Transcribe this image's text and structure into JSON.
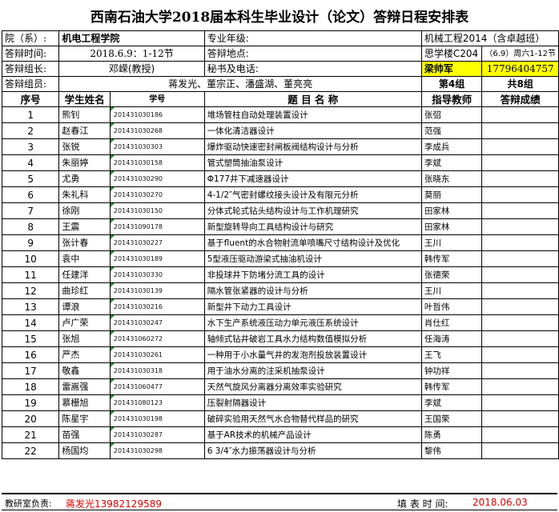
{
  "title": "西南石油大学2018届本科生毕业设计（论文）答辩日程安排表",
  "info": {
    "dept_label": "院（系）:",
    "dept_value": "机电工程学院",
    "major_label": "专业年级:",
    "major_value": "机械工程2014（含卓越班）",
    "time_label": "答辩时间:",
    "time_value": "2018.6.9：1-12节",
    "place_label": "答辩地点:",
    "place_value": "思学楼C204",
    "note_value": "（6.9）周六1-12节",
    "leader_label": "答辩组长:",
    "leader_value": "邓嵘(教授)",
    "secretary_label": "秘书及电话:",
    "secretary_name": "梁帅军",
    "secretary_phone": "17796404757",
    "members_label": "答辩组员:",
    "members_value": "蒋发光、董宗正、潘盛湖、董亮亮",
    "group_no": "第4组",
    "group_total": "共8组"
  },
  "columns": {
    "no": "序号",
    "student": "学生姓名",
    "sid": "学号",
    "topic": "题 目 名 称",
    "advisor": "指导教师",
    "score": "答辩成绩"
  },
  "rows": [
    {
      "no": "1",
      "name": "熊钊",
      "sid": "201431030186",
      "topic": "堆场管柱自动处理装置设计",
      "advisor": "张弨"
    },
    {
      "no": "2",
      "name": "赵春江",
      "sid": "201431030268",
      "topic": "一体化清洁器设计",
      "advisor": "范强"
    },
    {
      "no": "3",
      "name": "张锐",
      "sid": "201431030303",
      "topic": "爆炸驱动快速密封闸板阀结构设计与分析",
      "advisor": "李成兵"
    },
    {
      "no": "4",
      "name": "朱丽婷",
      "sid": "201431030158",
      "topic": "管式塑筒抽油泵设计",
      "advisor": "李斌"
    },
    {
      "no": "5",
      "name": "尤勇",
      "sid": "201431030290",
      "topic": "Φ177井下减速器设计",
      "advisor": "张晓东"
    },
    {
      "no": "6",
      "name": "朱礼科",
      "sid": "201431030270",
      "topic": "4-1/2″气密封螺纹接头设计及有限元分析",
      "advisor": "莫丽"
    },
    {
      "no": "7",
      "name": "徐刚",
      "sid": "201431030150",
      "topic": "分体式轮式钻头结构设计与工作机理研究",
      "advisor": "田家林"
    },
    {
      "no": "8",
      "name": "王震",
      "sid": "201431090178",
      "topic": "新型旋转导向工具结构设计与研究",
      "advisor": "田家林"
    },
    {
      "no": "9",
      "name": "张计春",
      "sid": "201431030227",
      "topic": "基于fluent的水合物射流单喷嘴尺寸结构设计及优化",
      "advisor": "王川"
    },
    {
      "no": "10",
      "name": "袁中",
      "sid": "201431030189",
      "topic": "5型液压驱动游梁式抽油机设计",
      "advisor": "韩传军"
    },
    {
      "no": "11",
      "name": "任建洋",
      "sid": "201431030330",
      "topic": "非投球井下防堵分流工具的设计",
      "advisor": "张德荣"
    },
    {
      "no": "12",
      "name": "曲珍红",
      "sid": "201431030139",
      "topic": "隔水管张紧器的设计与分析",
      "advisor": "王川"
    },
    {
      "no": "13",
      "name": "谭浪",
      "sid": "201431030216",
      "topic": "新型井下动力工具设计",
      "advisor": "叶哲伟"
    },
    {
      "no": "14",
      "name": "卢广荣",
      "sid": "201431030247",
      "topic": "水下生产系统液压动力单元液压系统设计",
      "advisor": "肖仕红"
    },
    {
      "no": "15",
      "name": "张旭",
      "sid": "201431060272",
      "topic": "轴倾式钻井破岩工具水力结构数值模拟分析",
      "advisor": "任海涛"
    },
    {
      "no": "16",
      "name": "严杰",
      "sid": "201431030261",
      "topic": "一种用于小水量气井的发泡剂投放装置设计",
      "advisor": "王飞"
    },
    {
      "no": "17",
      "name": "敬鑫",
      "sid": "201431030318",
      "topic": "用于油水分离的注采机抽泵设计",
      "advisor": "钟功祥"
    },
    {
      "no": "18",
      "name": "雷嵩强",
      "sid": "201431060477",
      "topic": "天然气旋风分离器分离效率实验研究",
      "advisor": "韩传军"
    },
    {
      "no": "19",
      "name": "慕栅旭",
      "sid": "201431080123",
      "topic": "压裂射隔器设计",
      "advisor": "李斌"
    },
    {
      "no": "20",
      "name": "陈星宇",
      "sid": "201431030198",
      "topic": "破碎实验用天然气水合物替代样品的研究",
      "advisor": "王国荣"
    },
    {
      "no": "21",
      "name": "苗强",
      "sid": "201431030287",
      "topic": "基于AR技术的机械产品设计",
      "advisor": "陈勇"
    },
    {
      "no": "22",
      "name": "杨国均",
      "sid": "201431030298",
      "topic": "6 3/4″水力振荡器设计与分析",
      "advisor": "黎伟"
    }
  ],
  "footer": {
    "lead_label": "教研室负责:",
    "lead_value": "蒋发光13982129589",
    "date_label": "填 表 时 间:",
    "date_value": "2018.06.03"
  },
  "colors": {
    "highlight": "#ffff00",
    "red_text": "#e00000",
    "cell_marker": "#1a8a2a"
  }
}
